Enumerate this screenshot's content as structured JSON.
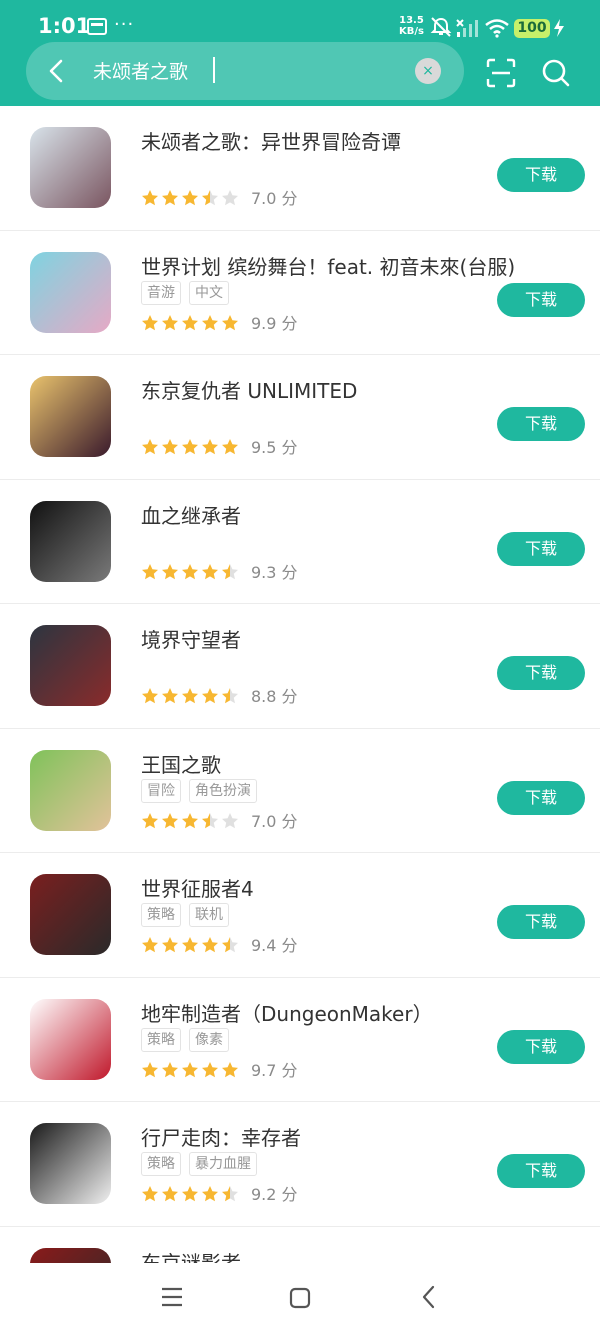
{
  "status_bar": {
    "time": "1:01",
    "net_speed_value": "13.5",
    "net_speed_unit": "KB/s",
    "battery": "100"
  },
  "search": {
    "query": "未颂者之歌",
    "clear_symbol": "×"
  },
  "apps": [
    {
      "name": "未颂者之歌：异世界冒险奇谭",
      "tags": [],
      "score": "7.0 分",
      "stars": 3.5,
      "download": "下载",
      "icon": "game-icon-knight",
      "colors": [
        "#d8e3ea",
        "#7a5560"
      ]
    },
    {
      "name": "世界计划 缤纷舞台！feat. 初音未來(台服)",
      "tags": [
        "音游",
        "中文"
      ],
      "score": "9.9 分",
      "stars": 5,
      "download": "下载",
      "icon": "game-icon-miku",
      "colors": [
        "#7fd3e0",
        "#e6a9c5"
      ]
    },
    {
      "name": "东京复仇者 UNLIMITED",
      "tags": [],
      "score": "9.5 分",
      "stars": 5,
      "download": "下载",
      "icon": "game-icon-revengers",
      "colors": [
        "#e9c36d",
        "#3a1a2c"
      ]
    },
    {
      "name": "血之继承者",
      "tags": [],
      "score": "9.3 分",
      "stars": 4.5,
      "download": "下载",
      "icon": "game-icon-netmarble",
      "colors": [
        "#111111",
        "#7a7a7a"
      ]
    },
    {
      "name": "境界守望者",
      "tags": [],
      "score": "8.8 分",
      "stars": 4.5,
      "download": "下载",
      "icon": "game-icon-wolf",
      "colors": [
        "#2c3540",
        "#8a2b2b"
      ]
    },
    {
      "name": "王国之歌",
      "tags": [
        "冒险",
        "角色扮演"
      ],
      "score": "7.0 分",
      "stars": 3.5,
      "download": "下载",
      "icon": "game-icon-kingdom",
      "colors": [
        "#7fc25a",
        "#e2c29a"
      ]
    },
    {
      "name": "世界征服者4",
      "tags": [
        "策略",
        "联机"
      ],
      "score": "9.4 分",
      "stars": 4.5,
      "download": "下载",
      "icon": "game-icon-conqueror",
      "colors": [
        "#7a1f1f",
        "#2a2a2a"
      ]
    },
    {
      "name": "地牢制造者（DungeonMaker）",
      "tags": [
        "策略",
        "像素"
      ],
      "score": "9.7 分",
      "stars": 5,
      "download": "下载",
      "icon": "game-icon-dungeon",
      "colors": [
        "#ffffff",
        "#c0182b"
      ]
    },
    {
      "name": "行尸走肉：幸存者",
      "tags": [
        "策略",
        "暴力血腥"
      ],
      "score": "9.2 分",
      "stars": 4.5,
      "download": "下载",
      "icon": "game-icon-walking-dead",
      "colors": [
        "#1a1a1a",
        "#f0f0f0"
      ]
    },
    {
      "name": "东京谜影者",
      "tags": [],
      "score": "",
      "stars": 0,
      "download": "",
      "icon": "game-icon-tokyo",
      "colors": [
        "#8a1a1a",
        "#2a2a2a"
      ]
    }
  ],
  "colors": {
    "accent": "#1fb89f",
    "star": "#f7b731",
    "star_empty": "#e0e0e0"
  }
}
